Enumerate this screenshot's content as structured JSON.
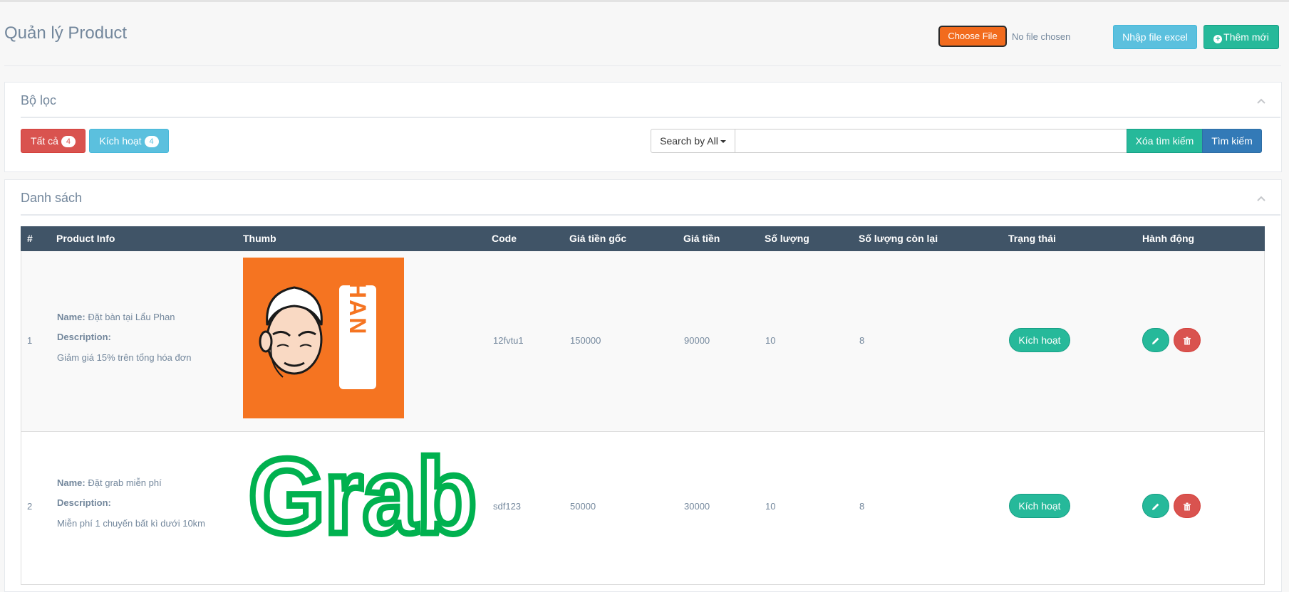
{
  "header": {
    "title": "Quản lý Product",
    "choose_file_label": "Choose File",
    "no_file_text": "No file chosen",
    "import_label": "Nhập file excel",
    "add_label": "Thêm mới"
  },
  "filter": {
    "title": "Bộ lọc",
    "all_label": "Tất cả",
    "all_count": "4",
    "active_label": "Kích hoạt",
    "active_count": "4",
    "search_by_label": "Search by All",
    "search_value": "",
    "clear_label": "Xóa tìm kiếm",
    "search_label": "Tìm kiếm"
  },
  "list": {
    "title": "Danh sách",
    "columns": [
      "#",
      "Product Info",
      "Thumb",
      "Code",
      "Giá tiền gốc",
      "Giá tiền",
      "Số lượng",
      "Số lượng còn lại",
      "Trạng thái",
      "Hành động"
    ],
    "name_label": "Name:",
    "description_label": "Description:",
    "rows": [
      {
        "index": "1",
        "name": "Đặt bàn tại Lẩu Phan",
        "description": "Giảm giá 15% trên tổng hóa đơn",
        "thumb_text": "PHAN",
        "code": "12fvtu1",
        "original_price": "150000",
        "price": "90000",
        "quantity": "10",
        "remaining": "8",
        "status": "Kích hoạt"
      },
      {
        "index": "2",
        "name": "Đặt grab miễn phí",
        "description": "Miễn phí  1 chuyến bất kì dưới 10km",
        "thumb_text": "Grab",
        "code": "sdf123",
        "original_price": "50000",
        "price": "30000",
        "quantity": "10",
        "remaining": "8",
        "status": "Kích hoạt"
      }
    ]
  },
  "icons": {
    "collapse": "chevron-up-icon",
    "add": "plus-circle-icon",
    "edit": "pencil-icon",
    "delete": "trash-icon"
  },
  "colors": {
    "header_bg": "#405467",
    "success": "#26b99a",
    "danger": "#d9534f",
    "info": "#5bc0de",
    "primary": "#337ab7",
    "file_button": "#f26b1d",
    "phan_orange": "#f57421",
    "grab_green": "#00b14f"
  }
}
